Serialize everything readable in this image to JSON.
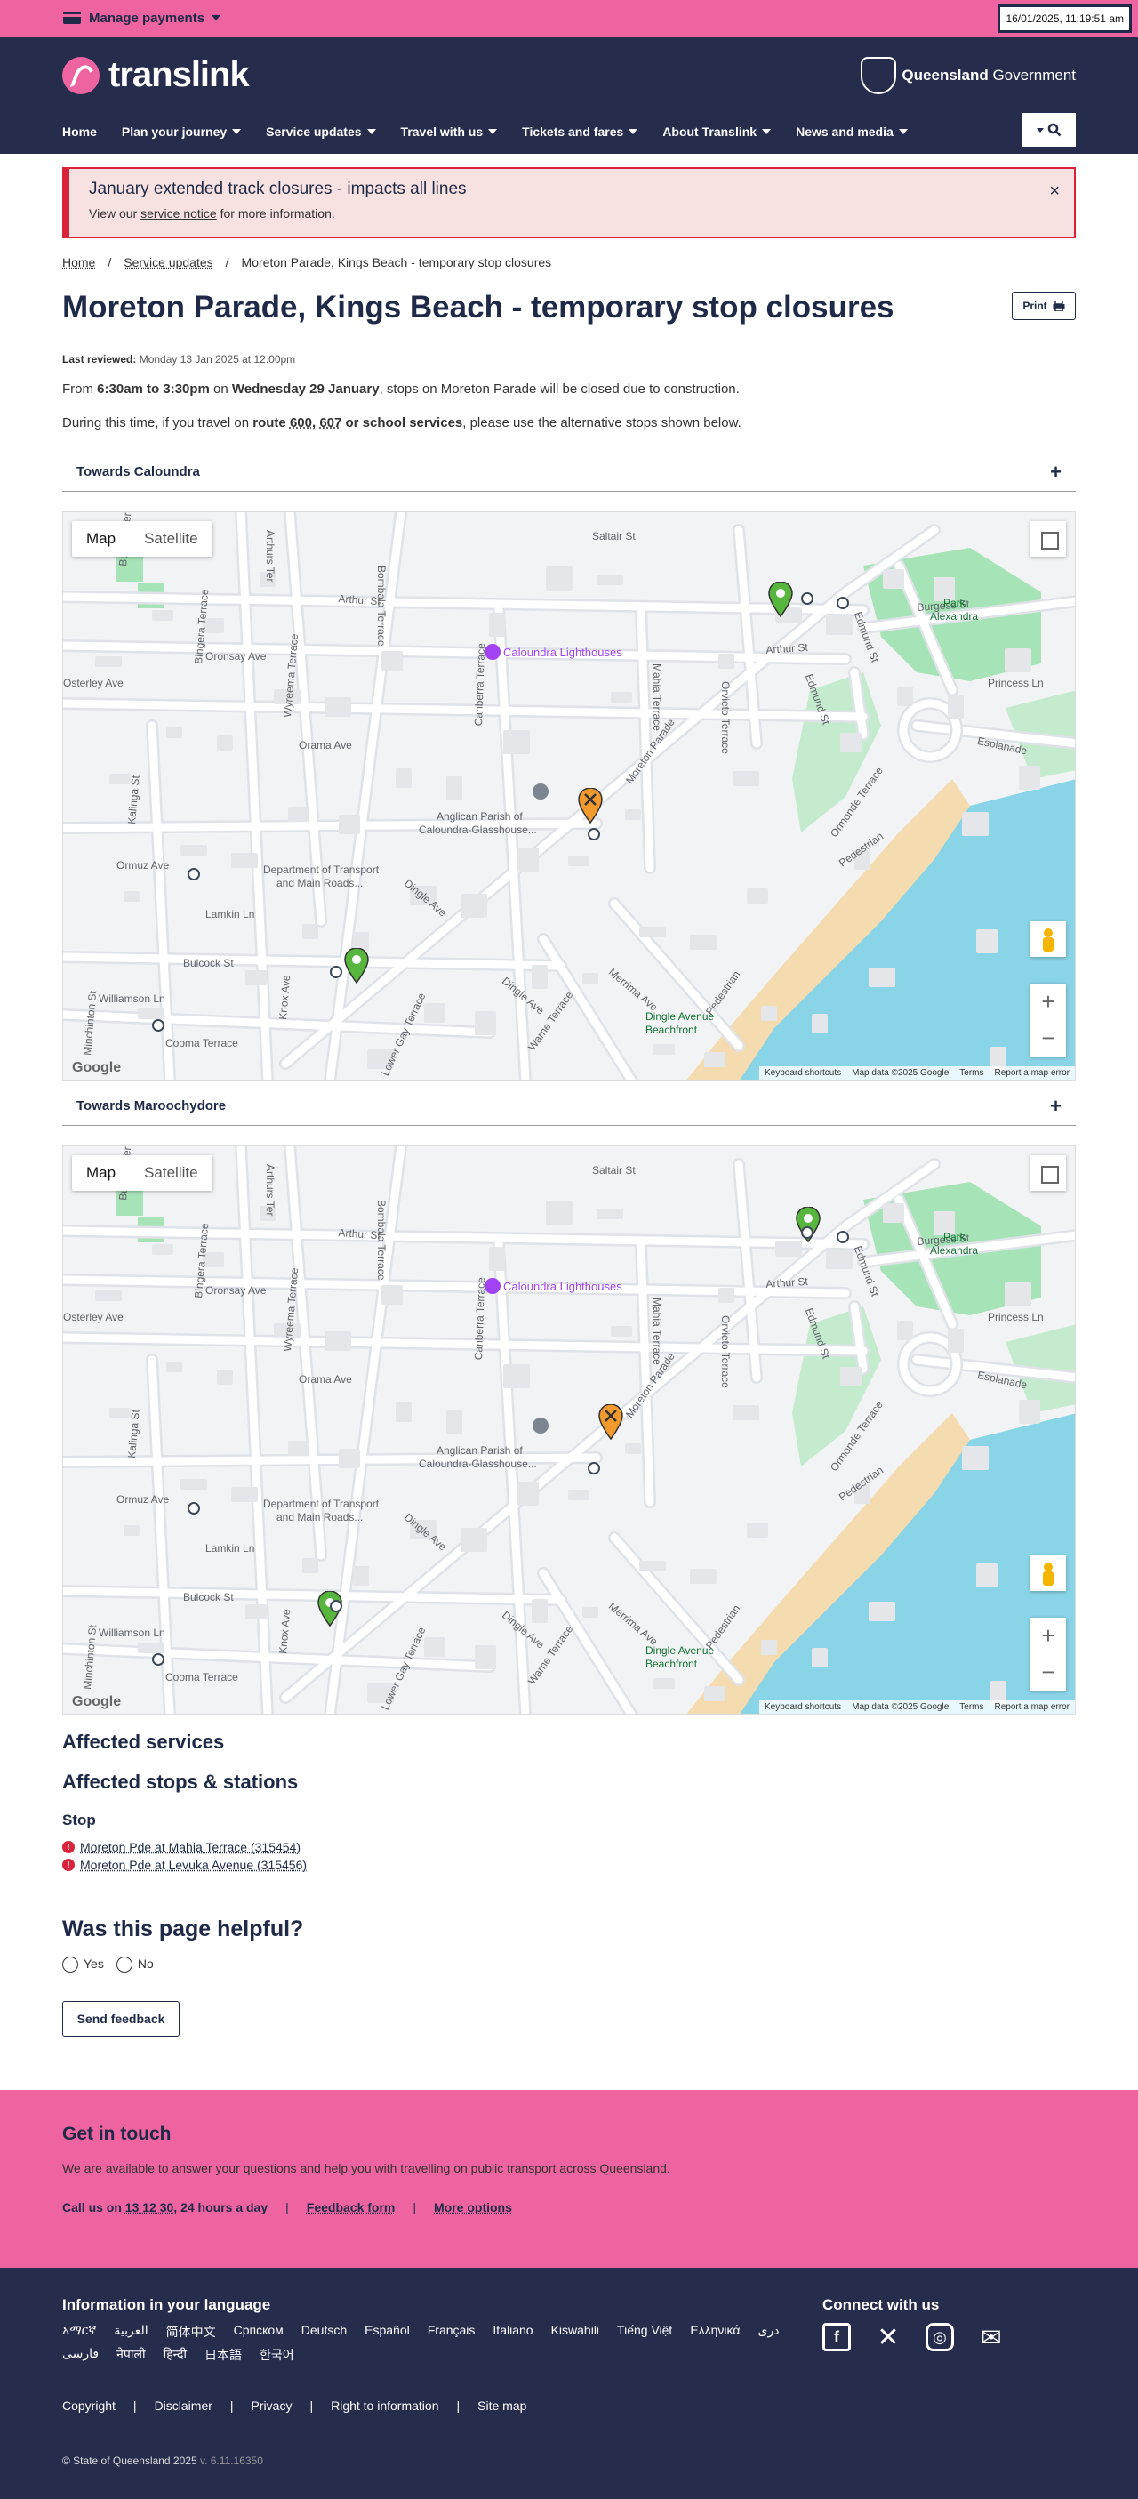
{
  "topbar": {
    "manage_label": "Manage payments",
    "clock": "16/01/2025, 11:19:51 am"
  },
  "header": {
    "logo": "translink",
    "gov_bold": "Queensland",
    "gov_rest": " Government",
    "nav": [
      {
        "label": "Home",
        "dropdown": false
      },
      {
        "label": "Plan your journey",
        "dropdown": true
      },
      {
        "label": "Service updates",
        "dropdown": true
      },
      {
        "label": "Travel with us",
        "dropdown": true
      },
      {
        "label": "Tickets and fares",
        "dropdown": true
      },
      {
        "label": "About Translink",
        "dropdown": true
      },
      {
        "label": "News and media",
        "dropdown": true
      }
    ]
  },
  "alert": {
    "title": "January extended track closures - impacts all lines",
    "pre": "View our ",
    "link": "service notice",
    "post": " for more information.",
    "close": "×"
  },
  "breadcrumb": {
    "home": "Home",
    "sep": "/",
    "updates": "Service updates",
    "current": "Moreton Parade, Kings Beach - temporary stop closures"
  },
  "page": {
    "title": "Moreton Parade, Kings Beach - temporary stop closures",
    "print": "Print",
    "reviewed_label": "Last reviewed:",
    "reviewed_value": " Monday 13 Jan 2025 at 12.00pm",
    "p1_a": "From ",
    "p1_b": "6:30am to 3:30pm",
    "p1_c": " on ",
    "p1_d": "Wednesday 29 January",
    "p1_e": ", stops on Moreton Parade will be closed due to construction.",
    "p2_a": "During this time, if you travel on ",
    "p2_route": "route",
    "p2_r1": "600",
    "p2_r2": "607",
    "p2_or": "or school services",
    "p2_e": ", please use the alternative stops shown below.",
    "comma": ","
  },
  "accordions": {
    "a1": "Towards Caloundra",
    "a2": "Towards Maroochydore",
    "plus": "+"
  },
  "map": {
    "tab_map": "Map",
    "tab_sat": "Satellite",
    "google": "Google",
    "attrib": [
      "Keyboard shortcuts",
      "Map data ©2025 Google",
      "Terms",
      "Report a map error"
    ],
    "labels": {
      "lighthouses": "Caloundra Lighthouses",
      "parish": "Anglican Parish of",
      "parish2": "Caloundra-Glasshouse...",
      "dept": "Department of Transport",
      "dept2": "and Main Roads...",
      "dingle": "Dingle Avenue",
      "dingle2": "Beachfront",
      "park": "Park",
      "park2": "Alexandra",
      "saltair": "Saltair St",
      "arthur": "Arthur St",
      "burgess": "Burgess St",
      "oronsay": "Oronsay Ave",
      "orama": "Orama Ave",
      "ormuz": "Ormuz Ave",
      "bulcock": "Bulcock St",
      "williamson": "Williamson Ln",
      "cooma": "Cooma Terrace",
      "lamkin": "Lamkin Ln",
      "princess": "Princess Ln",
      "esplanade": "Esplanade",
      "osterley": "Osterley Ave",
      "moreton": "Moreton Parade",
      "mahia": "Mahia Terrace",
      "orvieto": "Orvieto Terrace",
      "ormonde": "Ormonde Terrace",
      "canberra": "Canberra Terrace",
      "bombala": "Bombala Terrace",
      "wyreema": "Wyreema Terrace",
      "bingera": "Bingera Terrace",
      "burwah": "Burwah Terrace",
      "kalinga": "Kalinga St",
      "knox": "Knox Ave",
      "dingleave": "Dingle Ave",
      "warne": "Warne Terrace",
      "merrima": "Merrima Ave",
      "lowergay": "Lower Gay Terrace",
      "minchinton": "Minchinton St",
      "edmund": "Edmund St",
      "pedestrian": "Pedestrian",
      "arthurs": "Arthurs Ter"
    }
  },
  "affected": {
    "services": "Affected services",
    "stops_title": "Affected stops & stations",
    "stop_head": "Stop",
    "stops": [
      "Moreton Pde at Mahia Terrace (315454)",
      "Moreton Pde at Levuka Avenue (315456)"
    ],
    "bang": "!"
  },
  "feedback": {
    "title": "Was this page helpful?",
    "yes": "Yes",
    "no": "No",
    "send": "Send feedback"
  },
  "touch": {
    "title": "Get in touch",
    "desc": "We are available to answer your questions and help you with travelling on public transport across Queensland.",
    "call_pre": "Call us on ",
    "call_num": "13 12 30",
    "call_post": ", 24 hours a day",
    "sep": "|",
    "feedback": "Feedback form",
    "more": "More options"
  },
  "footer": {
    "lang_title": "Information in your language",
    "langs": [
      "አማርኛ",
      "العربية",
      "简体中文",
      "Српском",
      "Deutsch",
      "Español",
      "Français",
      "Italiano",
      "Kiswahili",
      "Tiếng Việt",
      "Ελληνικά",
      "دری",
      "فارسی",
      "नेपाली",
      "हिन्दी",
      "日本語",
      "한국어"
    ],
    "connect": "Connect with us",
    "legal": [
      "Copyright",
      "Disclaimer",
      "Privacy",
      "Right to information",
      "Site map"
    ],
    "sep": "|",
    "copy": "© State of Queensland 2025",
    "version": " v. 6.11.16350"
  },
  "colors": {
    "brand_pink": "#ee64a0",
    "navy": "#252c4c",
    "alert_red": "#d9233a",
    "water": "#8ad4e8",
    "park": "#a6e3b7",
    "pin_green": "#57b63d",
    "pin_orange": "#f29a2e"
  }
}
